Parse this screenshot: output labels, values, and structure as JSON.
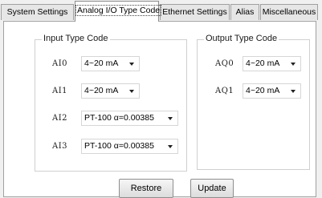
{
  "tabs": [
    {
      "label": "System Settings",
      "active": false
    },
    {
      "label": "Analog I/O Type Code",
      "active": true
    },
    {
      "label": "Ethernet Settings",
      "active": false
    },
    {
      "label": "Alias",
      "active": false
    },
    {
      "label": "Miscellaneous",
      "active": false
    }
  ],
  "input_group": {
    "title": "Input Type Code",
    "rows": [
      {
        "label": "AI0",
        "value": "4~20 mA"
      },
      {
        "label": "AI1",
        "value": "4~20 mA"
      },
      {
        "label": "AI2",
        "value": "PT-100 α=0.00385"
      },
      {
        "label": "AI3",
        "value": "PT-100 α=0.00385"
      }
    ]
  },
  "output_group": {
    "title": "Output Type Code",
    "rows": [
      {
        "label": "AQ0",
        "value": "4~20 mA"
      },
      {
        "label": "AQ1",
        "value": "4~20 mA"
      }
    ]
  },
  "buttons": {
    "restore": "Restore",
    "update": "Update"
  }
}
